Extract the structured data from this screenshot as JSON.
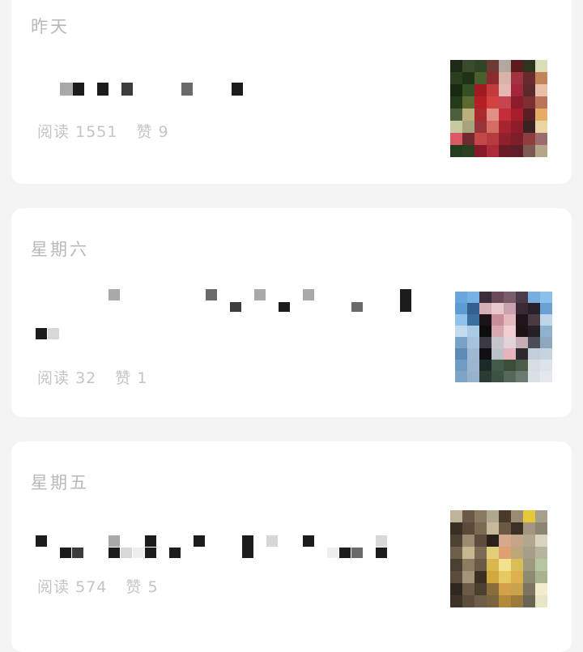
{
  "feed": [
    {
      "date": "昨天",
      "read_label": "阅读",
      "reads": "1551",
      "like_label": "赞",
      "likes": "9",
      "thumb_icon": "article-thumbnail",
      "thumb_colors": [
        "#1d2a18",
        "#3a4a2a",
        "#2f4524",
        "#6c3a35",
        "#b2a8a0",
        "#5e1b1d",
        "#2c361f",
        "#dcdcb8",
        "#2b3f20",
        "#1e3216",
        "#4a5f2e",
        "#8b2b2e",
        "#d9b2aa",
        "#9f3440",
        "#6a2a2d",
        "#c2835a",
        "#1a2a12",
        "#355025",
        "#9e1b22",
        "#c23a3e",
        "#e7b7b3",
        "#a4263a",
        "#5c2a2a",
        "#e9bfa8",
        "#243b1a",
        "#5a6a31",
        "#b41e25",
        "#d2433f",
        "#c64551",
        "#8d1c2b",
        "#7b2f2f",
        "#b9745a",
        "#4b5f3d",
        "#b9b07e",
        "#a92a2c",
        "#e38f86",
        "#c42e3a",
        "#a81d2c",
        "#5a1e24",
        "#e7ab66",
        "#c7caa1",
        "#a7a47b",
        "#97353a",
        "#d46d63",
        "#a8222f",
        "#8e1c2a",
        "#3a2221",
        "#e9d4a2",
        "#d95a63",
        "#6f2b2f",
        "#c44848",
        "#b63a3e",
        "#92202c",
        "#7d1e28",
        "#8e3e3f",
        "#9c6b6b",
        "#233d22",
        "#2c4020",
        "#851b2a",
        "#ad2c3a",
        "#6a1a25",
        "#5f1d27",
        "#7b5a53",
        "#b6a587"
      ]
    },
    {
      "date": "星期六",
      "read_label": "阅读",
      "reads": "32",
      "like_label": "赞",
      "likes": "1",
      "thumb_icon": "article-thumbnail",
      "thumb_colors": [
        "#6aa6dc",
        "#77b2e6",
        "#3b2c3a",
        "#6a4a5a",
        "#7a5c6b",
        "#4a3b4b",
        "#76aee2",
        "#8ac0ea",
        "#5d9bd3",
        "#365e91",
        "#d5aeb6",
        "#e7c8cc",
        "#caa1ae",
        "#3b2a35",
        "#2a2029",
        "#6aa0d4",
        "#8fc3ec",
        "#3a6f9e",
        "#1a1418",
        "#c98d96",
        "#e6b9bf",
        "#201519",
        "#4a3a43",
        "#bfd6ea",
        "#c3dbee",
        "#a9cbe6",
        "#0e0d10",
        "#d8a8ae",
        "#f0cfd3",
        "#1d1416",
        "#252028",
        "#8fb1cd",
        "#7aa2c9",
        "#a7c3db",
        "#3b3a44",
        "#c8c4cc",
        "#e0d2d8",
        "#c6adb7",
        "#4a4c56",
        "#8ea7be",
        "#5e8bb5",
        "#9db8d0",
        "#101012",
        "#b9c2c8",
        "#e7b4be",
        "#2d2a2e",
        "#c2cfda",
        "#c7d3de",
        "#6f9bc4",
        "#9cb6cd",
        "#1b2b2a",
        "#405b49",
        "#3c4d3a",
        "#4b5c4b",
        "#d6dde3",
        "#dde3e8",
        "#7ea4c8",
        "#97b3cc",
        "#2a3b34",
        "#3b5342",
        "#56685a",
        "#6b7b71",
        "#d9e0e6",
        "#e4e8ec"
      ]
    },
    {
      "date": "星期五",
      "read_label": "阅读",
      "reads": "574",
      "like_label": "赞",
      "likes": "5",
      "thumb_icon": "article-thumbnail",
      "thumb_colors": [
        "#bfb39a",
        "#6a5a45",
        "#8a7a62",
        "#b0a88e",
        "#4a3a2a",
        "#9a8c73",
        "#e2c83a",
        "#a6a08a",
        "#3a2f24",
        "#5a4a3a",
        "#7a6a52",
        "#c8b89a",
        "#6a5a45",
        "#3a3024",
        "#a29680",
        "#8d8572",
        "#4e4233",
        "#9a8a70",
        "#5b4c3b",
        "#2a2118",
        "#d8a88e",
        "#c6a48a",
        "#b2a68e",
        "#d7d3c0",
        "#6e5f4a",
        "#c6b78e",
        "#7b6a55",
        "#e3cf7a",
        "#dfa070",
        "#bca778",
        "#a59f8a",
        "#b6b59c",
        "#4a3f32",
        "#8b7c62",
        "#6a5a45",
        "#d8b84e",
        "#f2e28c",
        "#d8bd58",
        "#9e9a7e",
        "#b5c7a0",
        "#5a4b3a",
        "#a4957a",
        "#3a2f22",
        "#d1aa3e",
        "#e7c962",
        "#ddb24c",
        "#8e8a72",
        "#a8b28f",
        "#2f281f",
        "#6a5b46",
        "#4c3f30",
        "#8a6d3a",
        "#d2a24a",
        "#c9a24c",
        "#7a7460",
        "#f0eccc",
        "#3b3228",
        "#5c4d3a",
        "#6e5e48",
        "#7a6440",
        "#b28a3a",
        "#9b7a3e",
        "#6a6452",
        "#e9e6c8"
      ]
    }
  ]
}
